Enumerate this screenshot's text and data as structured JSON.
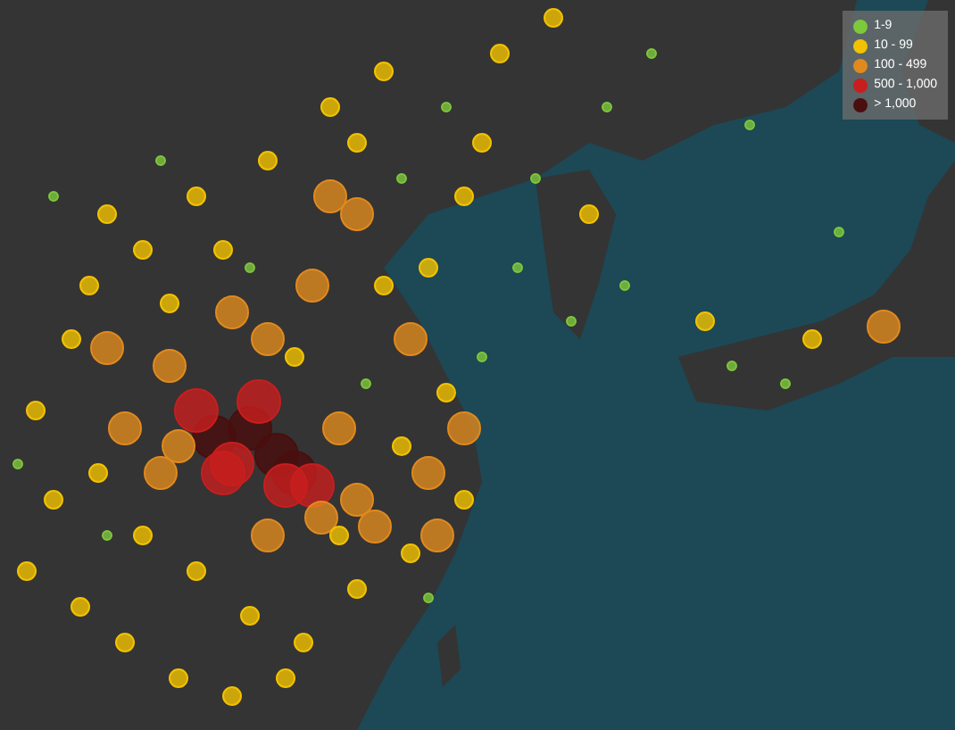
{
  "legend": {
    "items": [
      {
        "label": "1-9",
        "color": "#7ec83c"
      },
      {
        "label": "10 - 99",
        "color": "#f2c200"
      },
      {
        "label": "100 - 499",
        "color": "#e08a1e"
      },
      {
        "label": "500 - 1,000",
        "color": "#c81e1e"
      },
      {
        "label": "> 1,000",
        "color": "#4a0e0e"
      }
    ]
  }
}
